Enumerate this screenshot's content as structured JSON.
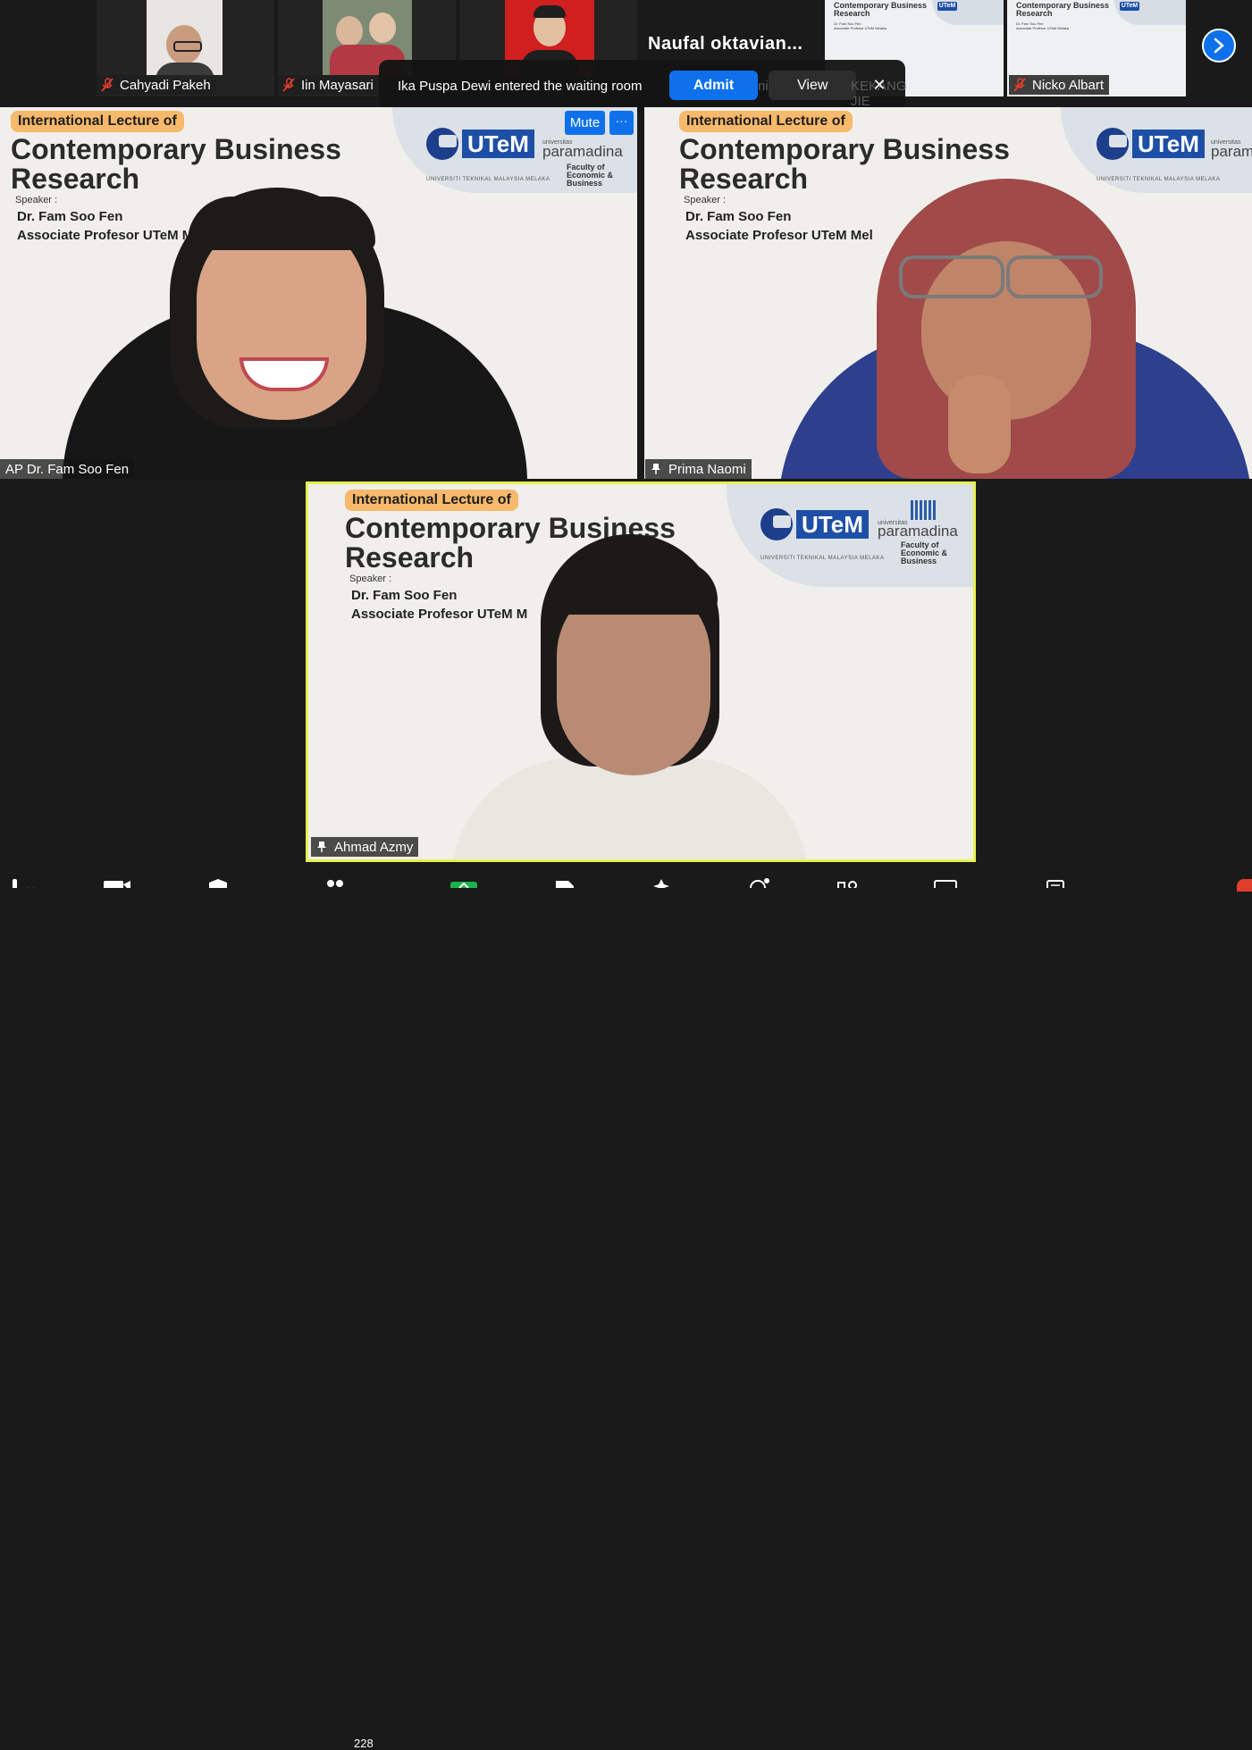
{
  "strip": {
    "participants": [
      {
        "name": "Cahyadi Pakeh",
        "muted": true
      },
      {
        "name": "Iin Mayasari",
        "muted": true
      },
      {
        "name": "Naufal  oktavian...",
        "muted": false
      },
      {
        "name": "Nicko Albart",
        "muted": true
      }
    ],
    "ghost_labels": [
      "nissa",
      "KEKANG JIE"
    ],
    "mini_slide": {
      "title": "Contemporary Business Research",
      "speaker": "Dr. Fam Soo Fen",
      "role": "Associate Profesor UTeM Melaka",
      "logo": "UTeM"
    }
  },
  "toast": {
    "message": "Ika Puspa Dewi entered the waiting room",
    "admit_label": "Admit",
    "view_label": "View",
    "close_glyph": "✕"
  },
  "slide": {
    "pill": "International  Lecture of",
    "title_line1": "Contemporary Business",
    "title_line2": "Research",
    "speaker_label": "Speaker :",
    "speaker_name": "Dr. Fam Soo Fen",
    "role_1": "Associate Profesor  UTeM M",
    "role_2": "Associate Profesor  UTeM Mel",
    "role_3": "Associate Profesor  UTeM M",
    "utem": "UTeM",
    "utem_sub": "UNIVERSITI TEKNIKAL MALAYSIA MELAKA",
    "pm_small": "universitas",
    "pm_word": "paramadina",
    "pm_word_cut": "param",
    "pm_fac1": "Faculty of",
    "pm_fac2": "Economic &",
    "pm_fac3": "Business"
  },
  "tiles": [
    {
      "name": "AP Dr. Fam Soo Fen",
      "pinned": false
    },
    {
      "name": "Prima Naomi",
      "pinned": true
    },
    {
      "name": "Ahmad Azmy",
      "pinned": true
    }
  ],
  "hover_controls": {
    "mute_label": "Mute",
    "more_glyph": "···"
  },
  "toolbar": {
    "participants_count": "228"
  },
  "colors": {
    "accent": "#0e71eb",
    "active_speaker": "#e7f24d",
    "pill": "#f7b96b",
    "utem_blue": "#1d4fa6"
  }
}
